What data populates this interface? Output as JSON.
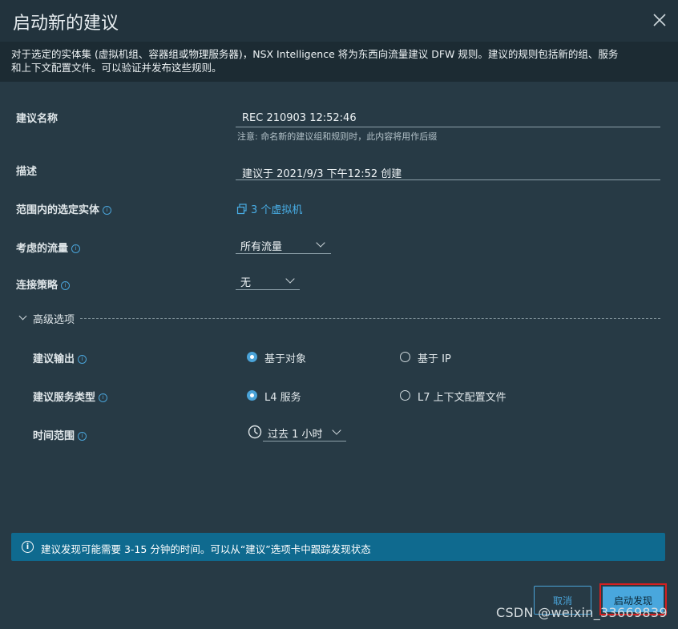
{
  "dialog": {
    "title": "启动新的建议",
    "description_line1": "对于选定的实体集 (虚拟机组、容器组或物理服务器)，NSX Intelligence 将为东西向流量建议 DFW 规则。建议的规则包括新的组、服务",
    "description_line2": "和上下文配置文件。可以验证并发布这些规则。"
  },
  "form": {
    "name_label": "建议名称",
    "name_value": "REC 210903 12:52:46",
    "name_note": "注意: 命名新的建议组和规则时，此内容将用作后缀",
    "desc_label": "描述",
    "desc_value": "建议于 2021/9/3 下午12:52 创建",
    "scope_label": "范围内的选定实体",
    "scope_value": "3 个虚拟机",
    "traffic_label": "考虑的流量",
    "traffic_value": "所有流量",
    "conn_label": "连接策略",
    "conn_value": "无"
  },
  "advanced": {
    "label": "高级选项",
    "output_label": "建议输出",
    "output_options": [
      "基于对象",
      "基于 IP"
    ],
    "output_selected": "基于对象",
    "service_label": "建议服务类型",
    "service_options": [
      "L4 服务",
      "L7 上下文配置文件"
    ],
    "service_selected": "L4 服务",
    "time_label": "时间范围",
    "time_value": "过去 1 小时"
  },
  "banner": {
    "text": "建议发现可能需要 3-15 分钟的时间。可以从“建议”选项卡中跟踪发现状态"
  },
  "buttons": {
    "cancel": "取消",
    "start": "启动发现"
  },
  "watermark": "CSDN @weixin_33669839",
  "colors": {
    "background": "#273a45",
    "accent": "#49a7dd",
    "banner": "#0f6a8f",
    "highlight": "#d42020"
  }
}
